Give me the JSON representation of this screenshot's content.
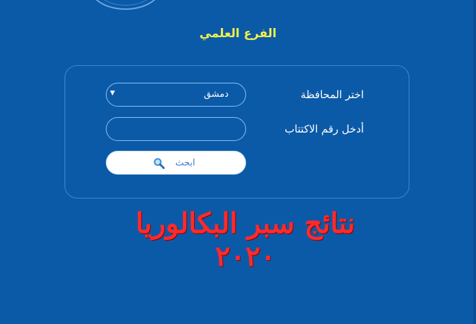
{
  "header": {
    "logo": "emblem-logo",
    "branch_title": "الفرع العلمي"
  },
  "form": {
    "province_label": "اختر المحافظة",
    "province_selected": "دمشق",
    "exam_number_label": "أدخل رقم الاكتتاب",
    "exam_number_value": "",
    "search_button_label": "ابحث",
    "search_icon": "magnifier-icon",
    "dropdown_icon": "triangle-down-icon"
  },
  "banner": {
    "headline": "نتائج سبر البكالوريا ٢٠٢٠"
  },
  "colors": {
    "background": "#0b5aa8",
    "title": "#f3f04a",
    "headline": "#ff2a2a",
    "border": "#8cc0f0"
  }
}
